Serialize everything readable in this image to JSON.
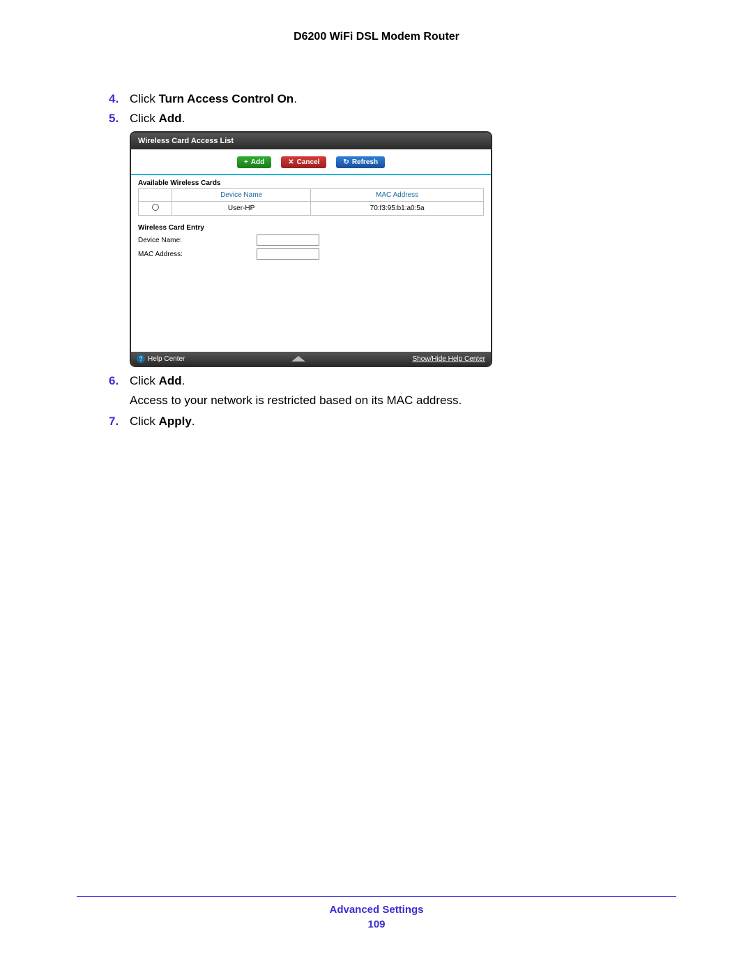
{
  "doc_title": "D6200 WiFi DSL Modem Router",
  "steps": {
    "s4": {
      "num": "4.",
      "prefix": "Click ",
      "bold": "Turn Access Control On",
      "suffix": "."
    },
    "s5": {
      "num": "5.",
      "prefix": "Click ",
      "bold": "Add",
      "suffix": "."
    },
    "s6": {
      "num": "6.",
      "prefix": "Click ",
      "bold": "Add",
      "suffix": ".",
      "sub": "Access to your network is restricted based on its MAC address."
    },
    "s7": {
      "num": "7.",
      "prefix": "Click ",
      "bold": "Apply",
      "suffix": "."
    }
  },
  "ui": {
    "title": "Wireless Card Access List",
    "buttons": {
      "add": "Add",
      "cancel": "Cancel",
      "refresh": "Refresh"
    },
    "icons": {
      "add": "+",
      "cancel": "✕",
      "refresh": "↻"
    },
    "available_section": "Available Wireless Cards",
    "columns": {
      "device": "Device Name",
      "mac": "MAC Address"
    },
    "row": {
      "device": "User-HP",
      "mac": "70:f3:95:b1:a0:5a"
    },
    "entry_section": "Wireless Card Entry",
    "labels": {
      "device": "Device Name:",
      "mac": "MAC Address:"
    },
    "footer": {
      "help": "Help Center",
      "showhide": "Show/Hide Help Center"
    }
  },
  "footer": {
    "section": "Advanced Settings",
    "page": "109"
  }
}
